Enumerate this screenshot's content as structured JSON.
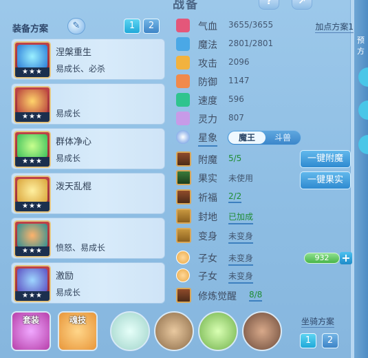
{
  "title": "战备",
  "header": {
    "help_icon_label": "?",
    "right_panel_chars": [
      "预",
      "方"
    ]
  },
  "equip_scheme": {
    "label": "装备方案",
    "tabs": [
      "1",
      "2"
    ],
    "active_tab": "1",
    "items": [
      {
        "name": "涅槃重生",
        "traits": "易成长、必杀",
        "stars": "★★★",
        "art_color": "#2a7bd8"
      },
      {
        "name": "",
        "traits": "易成长",
        "stars": "★★★",
        "art_color": "#b8423d"
      },
      {
        "name": "群体净心",
        "traits": "易成长",
        "stars": "★★★",
        "art_color": "#3bbf5a"
      },
      {
        "name": "泼天乱棍",
        "traits": "",
        "stars": "★★★",
        "art_color": "#d9a43a"
      },
      {
        "name": "",
        "traits": "愤怒、易成长",
        "stars": "★★★",
        "art_color": "#2d8f93"
      },
      {
        "name": "激励",
        "traits": "易成长",
        "stars": "★★★",
        "art_color": "#5c4fc2"
      }
    ]
  },
  "stats": {
    "add_point_scheme": "加点方案1",
    "rows": [
      {
        "label": "气血",
        "value": "3655/3655",
        "icon_color": "#e4577a"
      },
      {
        "label": "魔法",
        "value": "2801/2801",
        "icon_color": "#4aa8e6"
      },
      {
        "label": "攻击",
        "value": "2096",
        "icon_color": "#f2b23e"
      },
      {
        "label": "防御",
        "value": "1147",
        "icon_color": "#f08a4b"
      },
      {
        "label": "速度",
        "value": "596",
        "icon_color": "#2fc48e"
      },
      {
        "label": "灵力",
        "value": "807",
        "icon_color": "#c79be8"
      }
    ],
    "constellation": {
      "label": "星象",
      "options": [
        "魔王",
        "斗兽"
      ],
      "selected": "魔王"
    }
  },
  "growth": {
    "rows": [
      {
        "label": "附魔",
        "value": "5/5",
        "value_style": "green"
      },
      {
        "label": "果实",
        "value": "未使用",
        "value_style": "normal"
      },
      {
        "label": "祈福",
        "value": "2/2",
        "value_style": "green-underlined"
      },
      {
        "label": "封地",
        "value": "已加成",
        "value_style": "green-underlined"
      },
      {
        "label": "变身",
        "value": "未变身",
        "value_style": "underlined"
      },
      {
        "label": "子女",
        "value": "未变身",
        "value_style": "underlined"
      },
      {
        "label": "子女",
        "value": "未变身",
        "value_style": "underlined"
      },
      {
        "label": "修炼觉醒",
        "value": "8/8",
        "value_style": "green-underlined"
      }
    ],
    "one_click_enchant": "一键附魔",
    "one_click_fruit": "一键果实",
    "child_exp": "932",
    "plus": "+"
  },
  "bottom": {
    "slots": [
      {
        "label": "套装",
        "color": "#b63fa9"
      },
      {
        "label": "魂技",
        "color": "#e8963a"
      },
      {
        "label": "",
        "color": "#9fd3c9"
      },
      {
        "label": "",
        "color": "#8a6a47"
      },
      {
        "label": "",
        "color": "#6fb04a"
      },
      {
        "label": "",
        "color": "#6b4a3a"
      }
    ],
    "mount_scheme": {
      "label": "坐骑方案",
      "tabs": [
        "1",
        "2"
      ],
      "active_tab": "1"
    }
  },
  "colors": {
    "background": "#8dbde3",
    "accent": "#1fa9d9",
    "green_text": "#1f8c34"
  }
}
